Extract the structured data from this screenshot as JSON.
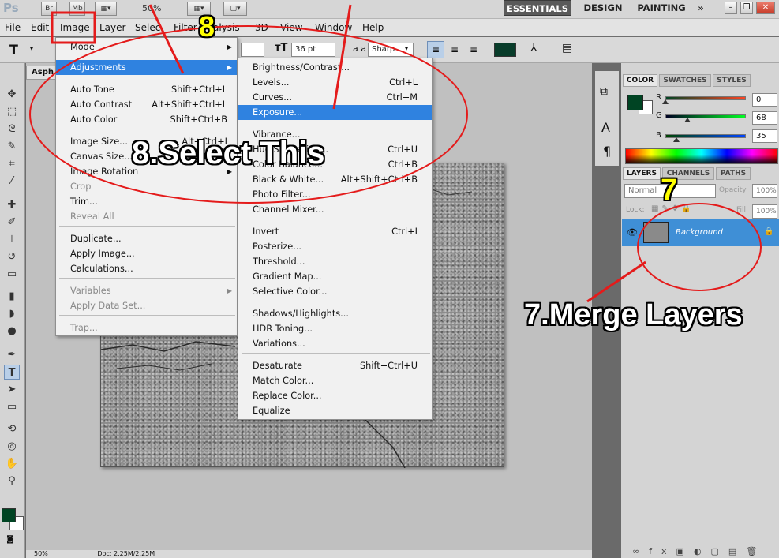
{
  "app": {
    "logo": "Ps",
    "badges": [
      "Br",
      "Mb"
    ],
    "zoom": "50%",
    "workspaces": [
      "ESSENTIALS",
      "DESIGN",
      "PAINTING"
    ],
    "more": "»"
  },
  "menubar": [
    "File",
    "Edit",
    "Image",
    "Layer",
    "Selec",
    "Filter",
    "alysis",
    "3D",
    "View",
    "Window",
    "Help"
  ],
  "options": {
    "tool_glyph": "T",
    "font_size": "36 pt",
    "aa_label": "a a",
    "antialias": "Sharp",
    "text_color": "#083c2a"
  },
  "document": {
    "tab": "Asph",
    "status_zoom": "50%",
    "status_doc": "Doc: 2.25M/2.25M"
  },
  "image_menu": {
    "items": [
      {
        "label": "Mode",
        "shortcut": "",
        "submenu": true,
        "disabled": false
      },
      {
        "label": "Adjustments",
        "shortcut": "",
        "submenu": true,
        "highlighted": true
      },
      {
        "label": "Auto Tone",
        "shortcut": "Shift+Ctrl+L"
      },
      {
        "label": "Auto Contrast",
        "shortcut": "Alt+Shift+Ctrl+L"
      },
      {
        "label": "Auto Color",
        "shortcut": "Shift+Ctrl+B"
      },
      {
        "label": "Image Size...",
        "shortcut": "Alt+Ctrl+I"
      },
      {
        "label": "Canvas Size...",
        "shortcut": "Alt+Ctrl+C"
      },
      {
        "label": "Image Rotation",
        "shortcut": "",
        "submenu": true
      },
      {
        "label": "Crop",
        "shortcut": "",
        "disabled": true
      },
      {
        "label": "Trim...",
        "shortcut": ""
      },
      {
        "label": "Reveal All",
        "shortcut": "",
        "disabled": true
      },
      {
        "label": "Duplicate...",
        "shortcut": ""
      },
      {
        "label": "Apply Image...",
        "shortcut": ""
      },
      {
        "label": "Calculations...",
        "shortcut": ""
      },
      {
        "label": "Variables",
        "shortcut": "",
        "submenu": true,
        "disabled": true
      },
      {
        "label": "Apply Data Set...",
        "shortcut": "",
        "disabled": true
      },
      {
        "label": "Trap...",
        "shortcut": "",
        "disabled": true
      }
    ]
  },
  "adjust_menu": {
    "items": [
      {
        "label": "Brightness/Contrast...",
        "shortcut": ""
      },
      {
        "label": "Levels...",
        "shortcut": "Ctrl+L"
      },
      {
        "label": "Curves...",
        "shortcut": "Ctrl+M"
      },
      {
        "label": "Exposure...",
        "shortcut": "",
        "highlighted": true
      },
      {
        "label": "Vibrance...",
        "shortcut": ""
      },
      {
        "label": "Hue/Saturation...",
        "shortcut": "Ctrl+U"
      },
      {
        "label": "Color Balance...",
        "shortcut": "Ctrl+B"
      },
      {
        "label": "Black & White...",
        "shortcut": "Alt+Shift+Ctrl+B"
      },
      {
        "label": "Photo Filter...",
        "shortcut": ""
      },
      {
        "label": "Channel Mixer...",
        "shortcut": ""
      },
      {
        "label": "Invert",
        "shortcut": "Ctrl+I"
      },
      {
        "label": "Posterize...",
        "shortcut": ""
      },
      {
        "label": "Threshold...",
        "shortcut": ""
      },
      {
        "label": "Gradient Map...",
        "shortcut": ""
      },
      {
        "label": "Selective Color...",
        "shortcut": ""
      },
      {
        "label": "Shadows/Highlights...",
        "shortcut": ""
      },
      {
        "label": "HDR Toning...",
        "shortcut": ""
      },
      {
        "label": "Variations...",
        "shortcut": ""
      },
      {
        "label": "Desaturate",
        "shortcut": "Shift+Ctrl+U"
      },
      {
        "label": "Match Color...",
        "shortcut": ""
      },
      {
        "label": "Replace Color...",
        "shortcut": ""
      },
      {
        "label": "Equalize",
        "shortcut": ""
      }
    ]
  },
  "color_panel": {
    "tabs": [
      "COLOR",
      "SWATCHES",
      "STYLES"
    ],
    "channels": [
      {
        "name": "R",
        "value": "0",
        "level": 0
      },
      {
        "name": "G",
        "value": "68",
        "level": 0.27
      },
      {
        "name": "B",
        "value": "35",
        "level": 0.14
      }
    ],
    "foreground": "#004423"
  },
  "layers_panel": {
    "tabs": [
      "LAYERS",
      "CHANNELS",
      "PATHS"
    ],
    "blend_mode": "Normal",
    "opacity_label": "Opacity:",
    "opacity": "100%",
    "lock_label": "Lock:",
    "fill_label": "Fill:",
    "fill": "100%",
    "layer_name": "Background"
  },
  "annotations": {
    "step8_number": "8",
    "step8_text": "8.Select This",
    "step7_number": "7",
    "step7_text": "7.Merge Layers"
  }
}
